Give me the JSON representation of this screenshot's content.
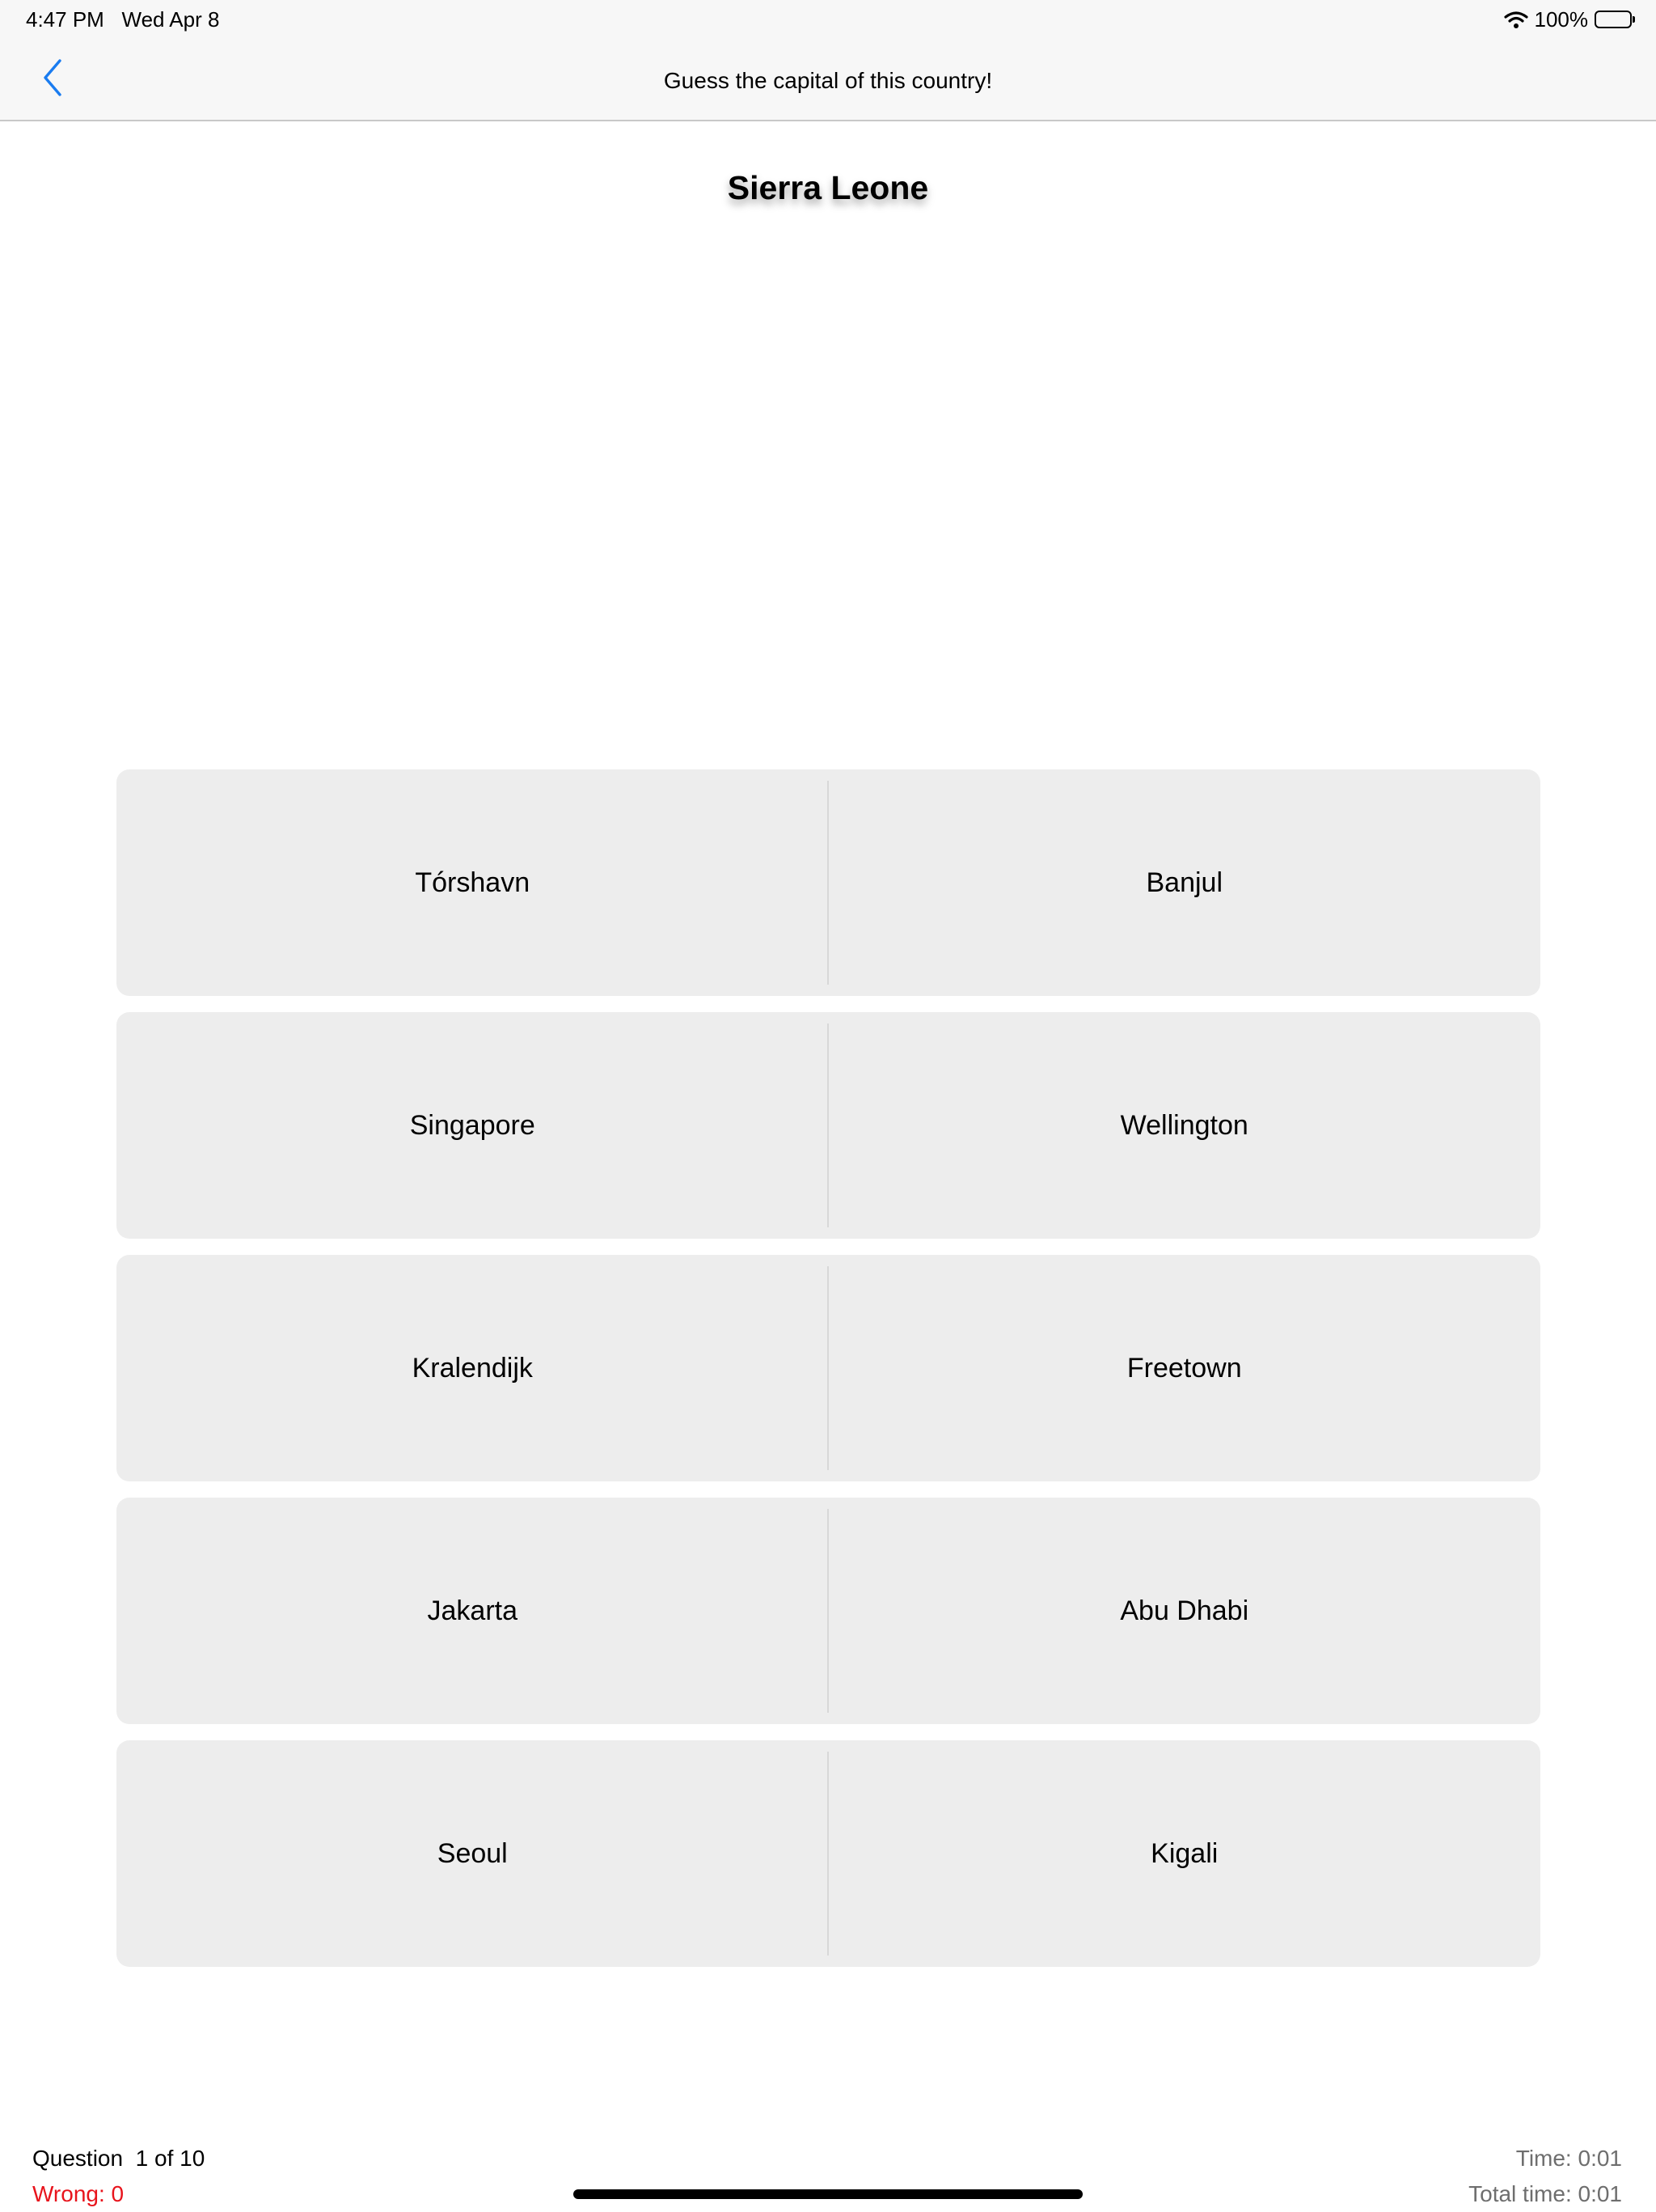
{
  "status_bar": {
    "time": "4:47 PM",
    "date": "Wed Apr 8",
    "battery": "100%",
    "battery_level": 1.0,
    "wifi_icon": "wifi-icon",
    "battery_icon": "battery-icon"
  },
  "nav": {
    "title": "Guess the capital of this country!",
    "back_icon": "chevron-left-icon",
    "accent": "#1a7cf0"
  },
  "question": {
    "country": "Sierra Leone"
  },
  "answers": [
    [
      "Tórshavn",
      "Banjul"
    ],
    [
      "Singapore",
      "Wellington"
    ],
    [
      "Kralendijk",
      "Freetown"
    ],
    [
      "Jakarta",
      "Abu Dhabi"
    ],
    [
      "Seoul",
      "Kigali"
    ]
  ],
  "footer": {
    "question_label": "Question",
    "progress": "1 of 10",
    "wrong": "Wrong: 0",
    "time": "Time: 0:01",
    "total_time": "Total time: 0:01",
    "wrong_color": "#e8141c"
  }
}
